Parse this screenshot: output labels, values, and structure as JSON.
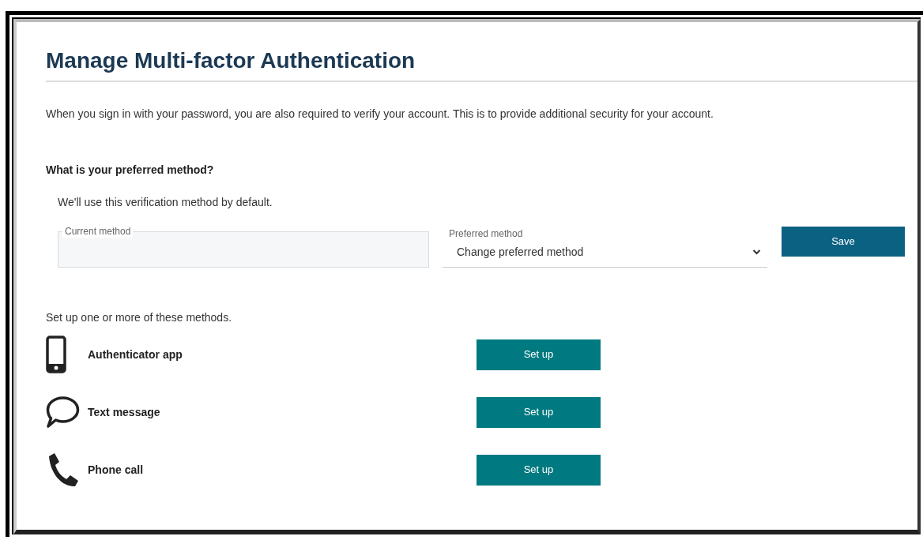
{
  "title": "Manage Multi-factor Authentication",
  "intro": "When you sign in with your password, you are also required to verify your account. This is to provide additional security for your account.",
  "preferred": {
    "heading": "What is your preferred method?",
    "hint": "We'll use this verification method by default.",
    "current_field": {
      "label": "Current method"
    },
    "preferred_field": {
      "label": "Preferred method",
      "value": "Change preferred method"
    },
    "save_button": "Save"
  },
  "setup_intro": "Set up one or more of these methods.",
  "methods": [
    {
      "kind": "mobile",
      "label": "Authenticator app",
      "button": "Set up"
    },
    {
      "kind": "chat",
      "label": "Text message",
      "button": "Set up"
    },
    {
      "kind": "call",
      "label": "Phone call",
      "button": "Set up"
    }
  ]
}
